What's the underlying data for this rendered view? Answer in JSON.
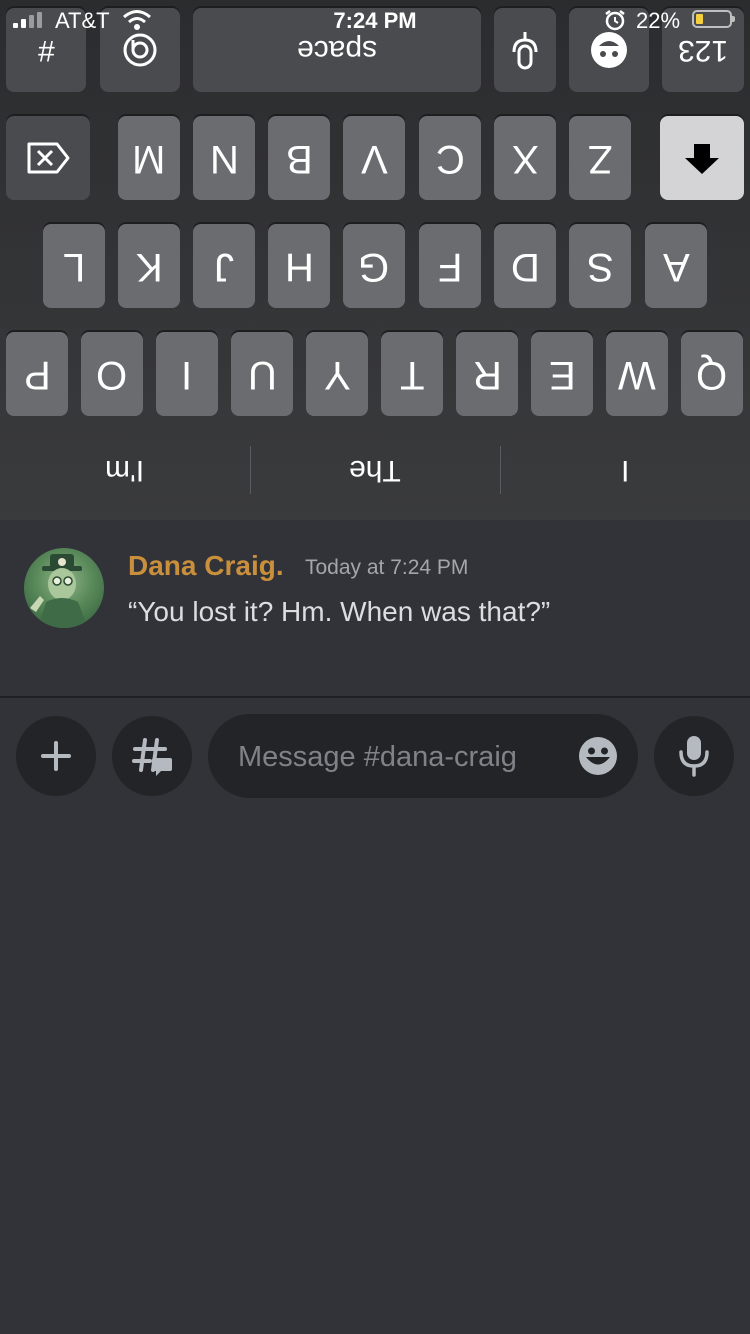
{
  "status_bar": {
    "carrier": "AT&T",
    "time": "7:24 PM",
    "battery_percent": "22%",
    "battery_level": 0.22,
    "icons": [
      "signal-icon",
      "wifi-icon",
      "alarm-icon",
      "battery-icon"
    ]
  },
  "keyboard": {
    "orientation": "upside-down",
    "top_row": [
      {
        "label": "#",
        "name": "key-hash"
      },
      {
        "label": "ⓖ",
        "name": "key-gif"
      },
      {
        "label": "space",
        "name": "key-space"
      },
      {
        "label": "🎤",
        "name": "key-dictation",
        "icon": "microphone-icon"
      },
      {
        "label": "☺",
        "name": "key-emoji",
        "icon": "emoji-icon"
      },
      {
        "label": "123",
        "name": "key-numbers"
      }
    ],
    "row_zm": [
      "M",
      "N",
      "B",
      "V",
      "C",
      "X",
      "Z"
    ],
    "row_la": [
      "L",
      "K",
      "J",
      "H",
      "G",
      "F",
      "D",
      "S",
      "A"
    ],
    "row_pq": [
      "P",
      "O",
      "I",
      "U",
      "Y",
      "T",
      "R",
      "E",
      "W",
      "Q"
    ],
    "suggestions": [
      "I'm",
      "The",
      "I"
    ],
    "icons": [
      "backspace-icon",
      "return-arrow-icon"
    ]
  },
  "message": {
    "author": "Dana Craig.",
    "timestamp": "Today at 7:24 PM",
    "content": "“You lost it? Hm. When was that?”",
    "author_color": "#c98f3c"
  },
  "composer": {
    "placeholder": "Message #dana-craig",
    "value": "",
    "icons": [
      "plus-icon",
      "threads-icon",
      "emoji-icon",
      "microphone-icon"
    ]
  },
  "colors": {
    "background": "#313338",
    "input_background": "#232428"
  }
}
